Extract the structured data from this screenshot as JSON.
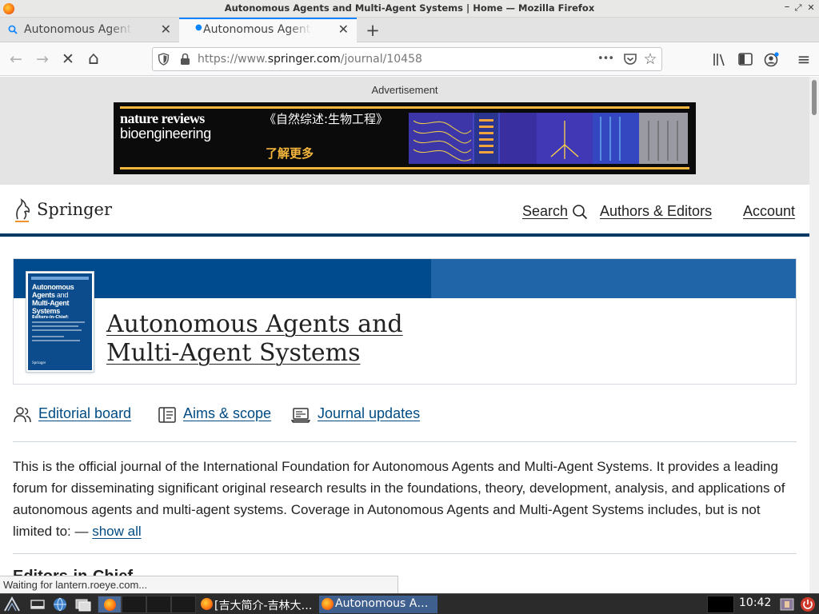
{
  "window": {
    "title": "Autonomous Agents and Multi-Agent Systems | Home — Mozilla Firefox",
    "minimize_glyph": "–",
    "restore_glyph": "⤢",
    "close_glyph": "✕"
  },
  "tabs": [
    {
      "label": "Autonomous Agents and Multi-Agent Systems",
      "active": false,
      "icon": "search-icon"
    },
    {
      "label": "Autonomous Agents and Multi-Agent Systems | Home",
      "active": true,
      "icon": "loading-dot-icon"
    }
  ],
  "toolbar": {
    "back_glyph": "←",
    "forward_glyph": "→",
    "stop_glyph": "✕",
    "home_glyph": "⌂",
    "url_prefix": "https://www.",
    "url_host": "springer.com",
    "url_path": "/journal/10458",
    "page_actions_glyph": "•••",
    "star_glyph": "☆",
    "menu_glyph": "≡",
    "library_glyph": "⫼"
  },
  "ad": {
    "label": "Advertisement",
    "brand_line1": "nature reviews",
    "brand_line2": "bioengineering",
    "headline": "《自然综述:生物工程》",
    "cta": "了解更多",
    "accent": "#f6b73c"
  },
  "header": {
    "logo_text": "Springer",
    "nav_search": "Search",
    "nav_authors": "Authors & Editors",
    "nav_account": "Account",
    "rule_color": "#003a63"
  },
  "journal": {
    "title_line1": "Autonomous Agents and",
    "title_line2": "Multi-Agent Systems",
    "cover_title_line1": "Autonomous",
    "cover_title_line2": "Agents",
    "cover_title_and": "and",
    "cover_title_line3": "Multi-Agent",
    "cover_title_line4": "Systems",
    "cover_editors": "Editors-in-Chief:",
    "cover_publisher": "Springer",
    "band_color": "#004b8d"
  },
  "journal_nav": [
    {
      "label": "Editorial board",
      "icon": "people-icon"
    },
    {
      "label": "Aims & scope",
      "icon": "book-icon"
    },
    {
      "label": "Journal updates",
      "icon": "laptop-icon"
    }
  ],
  "description": {
    "text": "This is the official journal of the International Foundation for Autonomous Agents and Multi-Agent Systems. It provides a leading forum for disseminating significant original research results in the foundations, theory, development, analysis, and applications of autonomous agents and multi-agent systems. Coverage in Autonomous Agents and Multi-Agent Systems includes, but is not limited to: — ",
    "show_all": "show all"
  },
  "next_section_heading": "Editors-in-Chief",
  "status": "Waiting for lantern.roeye.com...",
  "taskbar": {
    "task1": "[吉大简介-吉林大…",
    "task2": "Autonomous A…",
    "clock": "10:42"
  }
}
